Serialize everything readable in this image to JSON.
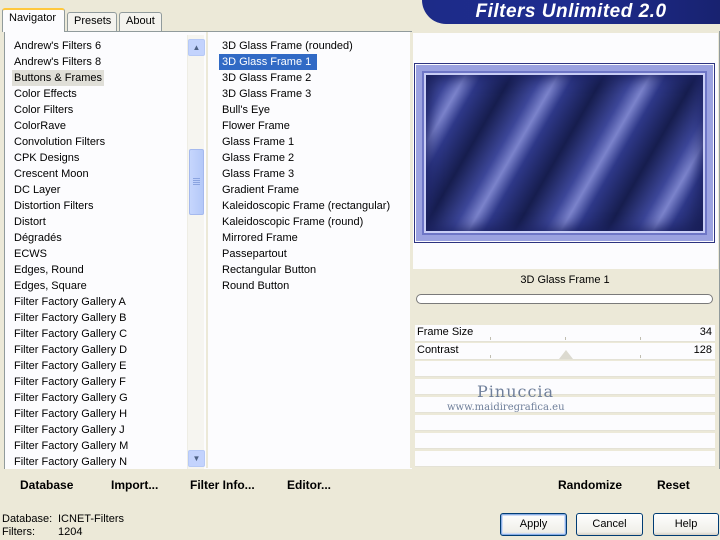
{
  "tabs": [
    {
      "label": "Navigator",
      "active": true
    },
    {
      "label": "Presets",
      "active": false
    },
    {
      "label": "About",
      "active": false
    }
  ],
  "banner_title": "Filters Unlimited 2.0",
  "categories": [
    "Andrew's Filters 6",
    "Andrew's Filters 8",
    "Buttons & Frames",
    "Color Effects",
    "Color Filters",
    "ColorRave",
    "Convolution Filters",
    "CPK Designs",
    "Crescent Moon",
    "DC Layer",
    "Distortion Filters",
    "Distort",
    "Dégradés",
    "ECWS",
    "Edges, Round",
    "Edges, Square",
    "Filter Factory Gallery A",
    "Filter Factory Gallery B",
    "Filter Factory Gallery C",
    "Filter Factory Gallery D",
    "Filter Factory Gallery E",
    "Filter Factory Gallery F",
    "Filter Factory Gallery G",
    "Filter Factory Gallery H",
    "Filter Factory Gallery J",
    "Filter Factory Gallery M",
    "Filter Factory Gallery N"
  ],
  "selected_category": "Buttons & Frames",
  "filters": [
    {
      "label": "3D Glass Frame (rounded)",
      "group": false
    },
    {
      "label": "3D Glass Frame 1",
      "group": false
    },
    {
      "label": "3D Glass Frame 2",
      "group": false
    },
    {
      "label": "3D Glass Frame 3",
      "group": false
    },
    {
      "label": "Bull's Eye",
      "group": false
    },
    {
      "label": "Flower Frame",
      "group": true
    },
    {
      "label": "Glass Frame 1",
      "group": false
    },
    {
      "label": "Glass Frame 2",
      "group": false
    },
    {
      "label": "Glass Frame 3",
      "group": false
    },
    {
      "label": "Gradient Frame",
      "group": true
    },
    {
      "label": "Kaleidoscopic Frame (rectangular)",
      "group": false
    },
    {
      "label": "Kaleidoscopic Frame (round)",
      "group": false
    },
    {
      "label": "Mirrored Frame",
      "group": false
    },
    {
      "label": "Passepartout",
      "group": true
    },
    {
      "label": "Rectangular Button",
      "group": false
    },
    {
      "label": "Round Button",
      "group": false
    }
  ],
  "selected_filter": "3D Glass Frame 1",
  "filter_title": "3D Glass Frame 1",
  "controls": [
    {
      "label": "Frame Size",
      "value": "34"
    },
    {
      "label": "Contrast",
      "value": "128"
    }
  ],
  "watermark": {
    "name": "Pinuccia",
    "url": "www.maidiregrafica.eu"
  },
  "bottom_links": {
    "database": "Database",
    "import": "Import...",
    "filter_info": "Filter Info...",
    "editor": "Editor...",
    "randomize": "Randomize",
    "reset": "Reset"
  },
  "status": {
    "database_label": "Database:",
    "database_value": "ICNET-Filters",
    "filters_label": "Filters:",
    "filters_value": "1204"
  },
  "buttons": {
    "apply": "Apply",
    "cancel": "Cancel",
    "help": "Help"
  },
  "colors": {
    "banner": "#1e2c8f",
    "selection": "#316ac5",
    "tab_highlight": "#ffc83c"
  }
}
